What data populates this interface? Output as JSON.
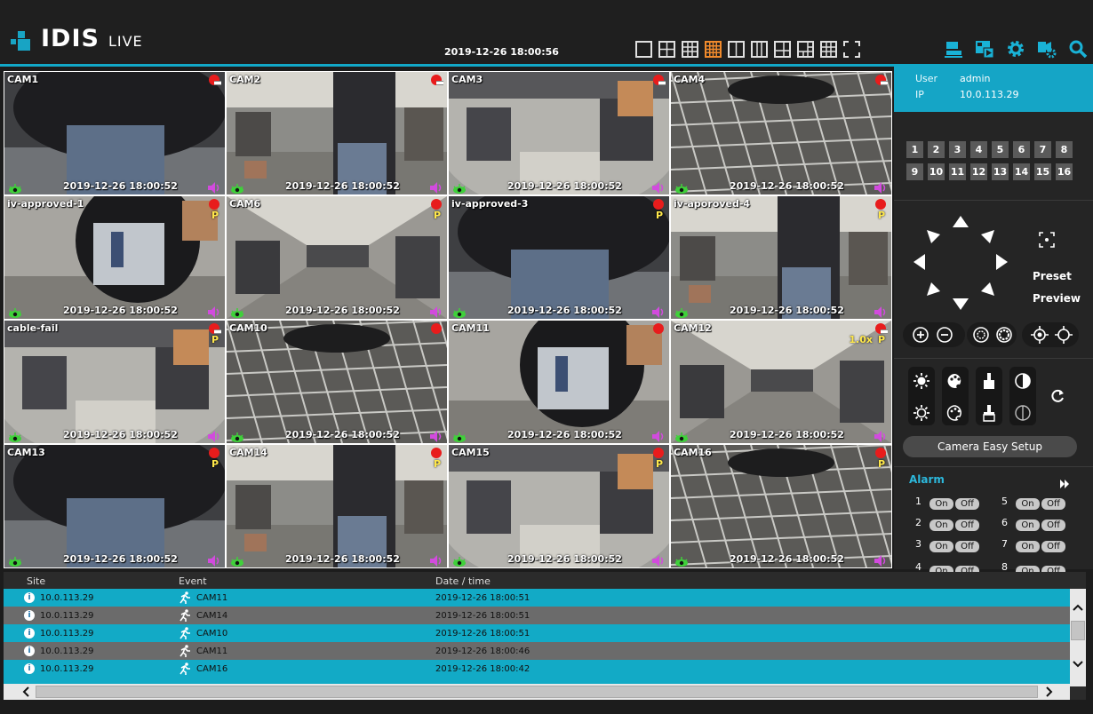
{
  "header": {
    "brand": "IDIS",
    "mode": "LIVE",
    "datetime": "2019-12-26 18:00:56",
    "layout_buttons": [
      "layout-1x1",
      "layout-2x2",
      "layout-3x3",
      "layout-4x4",
      "layout-1x2",
      "layout-1x3",
      "layout-1plus",
      "layout-1plus-5",
      "layout-1plus-7",
      "fullscreen"
    ],
    "active_layout": "layout-4x4",
    "tool_icons": [
      "network-icon",
      "playback-icon",
      "settings-icon",
      "camera-setup-icon",
      "search-icon"
    ],
    "accent_color": "#12a8c8",
    "active_layout_color": "#f08a2c"
  },
  "cameras": [
    {
      "name": "CAM1",
      "timestamp": "2019-12-26 18:00:52",
      "ptz": "",
      "zoom": "",
      "recbar": true,
      "selected": true
    },
    {
      "name": "CAM2",
      "timestamp": "2019-12-26 18:00:52",
      "ptz": "",
      "zoom": "",
      "recbar": true
    },
    {
      "name": "CAM3",
      "timestamp": "2019-12-26 18:00:52",
      "ptz": "",
      "zoom": "",
      "recbar": true
    },
    {
      "name": "CAM4",
      "timestamp": "2019-12-26 18:00:52",
      "ptz": "",
      "zoom": "",
      "recbar": true
    },
    {
      "name": "iv-approved-1",
      "timestamp": "2019-12-26 18:00:52",
      "ptz": "P",
      "zoom": "",
      "recbar": false
    },
    {
      "name": "CAM6",
      "timestamp": "2019-12-26 18:00:52",
      "ptz": "P",
      "zoom": "",
      "recbar": false
    },
    {
      "name": "iv-approved-3",
      "timestamp": "2019-12-26 18:00:52",
      "ptz": "P",
      "zoom": "",
      "recbar": false
    },
    {
      "name": "iv-aporoved-4",
      "timestamp": "2019-12-26 18:00:52",
      "ptz": "P",
      "zoom": "",
      "recbar": false
    },
    {
      "name": "cable-fail",
      "timestamp": "2019-12-26 18:00:52",
      "ptz": "P",
      "zoom": "",
      "recbar": true
    },
    {
      "name": "CAM10",
      "timestamp": "2019-12-26 18:00:52",
      "ptz": "",
      "zoom": "",
      "recbar": false
    },
    {
      "name": "CAM11",
      "timestamp": "2019-12-26 18:00:52",
      "ptz": "",
      "zoom": "",
      "recbar": false
    },
    {
      "name": "CAM12",
      "timestamp": "2019-12-26 18:00:52",
      "ptz": "P",
      "zoom": "1.0x",
      "recbar": true
    },
    {
      "name": "CAM13",
      "timestamp": "2019-12-26 18:00:52",
      "ptz": "P",
      "zoom": "",
      "recbar": false
    },
    {
      "name": "CAM14",
      "timestamp": "2019-12-26 18:00:52",
      "ptz": "P",
      "zoom": "",
      "recbar": false
    },
    {
      "name": "CAM15",
      "timestamp": "2019-12-26 18:00:52",
      "ptz": "P",
      "zoom": "",
      "recbar": false
    },
    {
      "name": "CAM16",
      "timestamp": "2019-12-26 18:00:52",
      "ptz": "P",
      "zoom": "",
      "recbar": false
    }
  ],
  "panel": {
    "user_label": "User",
    "user_value": "admin",
    "ip_label": "IP",
    "ip_value": "10.0.113.29",
    "channel_numbers": [
      "1",
      "2",
      "3",
      "4",
      "5",
      "6",
      "7",
      "8",
      "9",
      "10",
      "11",
      "12",
      "13",
      "14",
      "15",
      "16"
    ],
    "preset_label": "Preset",
    "preview_label": "Preview",
    "easy_setup_label": "Camera Easy Setup",
    "alarm_title": "Alarm",
    "alarm_on": "On",
    "alarm_off": "Off",
    "alarm_numbers": [
      "1",
      "2",
      "3",
      "4",
      "5",
      "6",
      "7",
      "8"
    ]
  },
  "events": {
    "columns": [
      "Site",
      "Event",
      "Date / time"
    ],
    "rows": [
      {
        "site": "10.0.113.29",
        "event": "CAM11",
        "time": "2019-12-26 18:00:51"
      },
      {
        "site": "10.0.113.29",
        "event": "CAM14",
        "time": "2019-12-26 18:00:51"
      },
      {
        "site": "10.0.113.29",
        "event": "CAM10",
        "time": "2019-12-26 18:00:51"
      },
      {
        "site": "10.0.113.29",
        "event": "CAM11",
        "time": "2019-12-26 18:00:46"
      },
      {
        "site": "10.0.113.29",
        "event": "CAM16",
        "time": "2019-12-26 18:00:42"
      }
    ],
    "row_colors": [
      "#12aac6",
      "#6b6b6b"
    ]
  }
}
